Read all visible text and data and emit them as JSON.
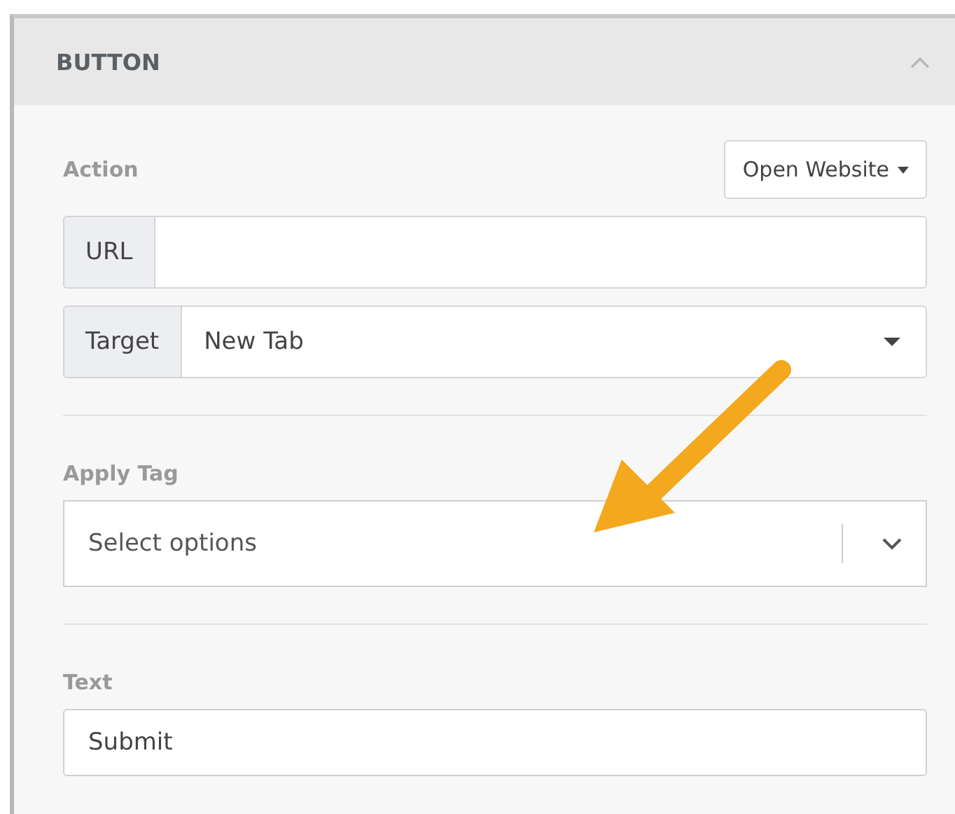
{
  "panel": {
    "title": "BUTTON",
    "expanded": true
  },
  "action": {
    "label": "Action",
    "value": "Open Website"
  },
  "url": {
    "label": "URL"
  },
  "target": {
    "label": "Target",
    "value": "New Tab"
  },
  "apply_tag": {
    "label": "Apply Tag",
    "placeholder": "Select options"
  },
  "text": {
    "label": "Text",
    "value": "Submit"
  }
}
